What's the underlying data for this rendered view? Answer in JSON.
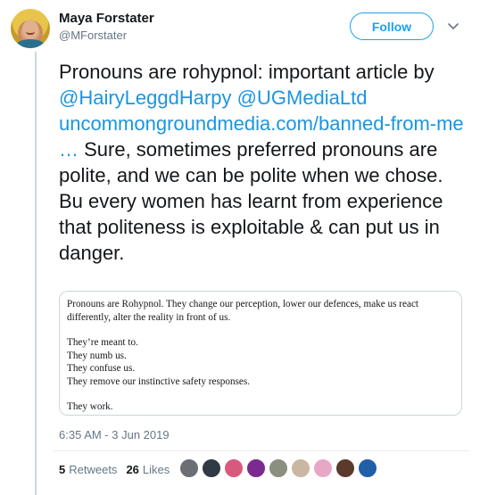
{
  "author": {
    "name": "Maya Forstater",
    "handle": "@MForstater"
  },
  "follow_label": "Follow",
  "tweet": {
    "text_1": "Pronouns are rohypnol: important article by ",
    "mention_1": "@HairyLeggdHarpy",
    "space": " ",
    "mention_2": "@UGMediaLtd",
    "link": "uncommongroundmedia.com/banned-from-me …",
    "text_2": " Sure, sometimes preferred pronouns are polite, and we can be polite when we chose. Bu every women has learnt from experience that politeness is exploitable & can put us in danger."
  },
  "quote": {
    "para_1": "Pronouns are Rohypnol. They change our perception, lower our defences, make us react differently, alter the reality in front of us.",
    "line_1": "They’re meant to.",
    "line_2": "They numb us.",
    "line_3": "They confuse us.",
    "line_4": "They remove our instinctive safety responses.",
    "line_5": "They work."
  },
  "timestamp": "6:35 AM - 3 Jun 2019",
  "stats": {
    "retweets_count": "5",
    "retweets_label": "Retweets",
    "likes_count": "26",
    "likes_label": "Likes"
  },
  "likers": [
    {
      "name": "liker-1",
      "color": "#6b6f73"
    },
    {
      "name": "liker-2",
      "color": "#2f3a44"
    },
    {
      "name": "liker-3",
      "color": "#d9597c"
    },
    {
      "name": "liker-4",
      "color": "#7b2a8f"
    },
    {
      "name": "liker-5",
      "color": "#8a8f80"
    },
    {
      "name": "liker-6",
      "color": "#c9b7a3"
    },
    {
      "name": "liker-7",
      "color": "#e9a7c8"
    },
    {
      "name": "liker-8",
      "color": "#5a3a2a"
    },
    {
      "name": "liker-9",
      "color": "#1f5fa8"
    }
  ]
}
